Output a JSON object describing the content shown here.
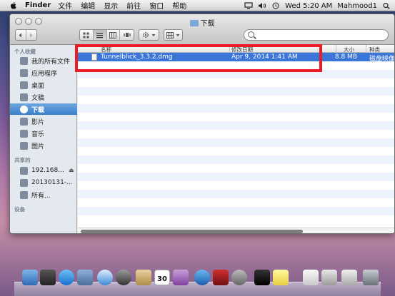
{
  "menubar": {
    "app": "Finder",
    "items": [
      "文件",
      "编辑",
      "显示",
      "前往",
      "窗口",
      "帮助"
    ],
    "clock": "Wed 5:20 AM",
    "user": "Mahmood1"
  },
  "window": {
    "title": "下载",
    "search_placeholder": ""
  },
  "sidebar": {
    "sections": [
      {
        "header": "个人收藏",
        "items": [
          "我的所有文件",
          "应用程序",
          "桌面",
          "文稿",
          "下载",
          "影片",
          "音乐",
          "图片"
        ]
      },
      {
        "header": "共享的",
        "items": [
          "192.168...",
          "20130131-...",
          "所有..."
        ]
      },
      {
        "header": "设备",
        "items": []
      }
    ],
    "selected": "下载"
  },
  "columns": {
    "name": "名称",
    "date": "修改日期",
    "size": "大小",
    "kind": "种类"
  },
  "files": [
    {
      "name": "Tunnelblick_3.3.2.dmg",
      "date": "Apr 9, 2014 1:41 AM",
      "size": "8.8 MB",
      "kind": "磁盘映像"
    }
  ],
  "dock": {
    "calendar_day": "30"
  },
  "colors": {
    "selection": "#3a75d7",
    "highlight_box": "#ec1c24",
    "sidebar_bg": "#e4e9ef"
  }
}
